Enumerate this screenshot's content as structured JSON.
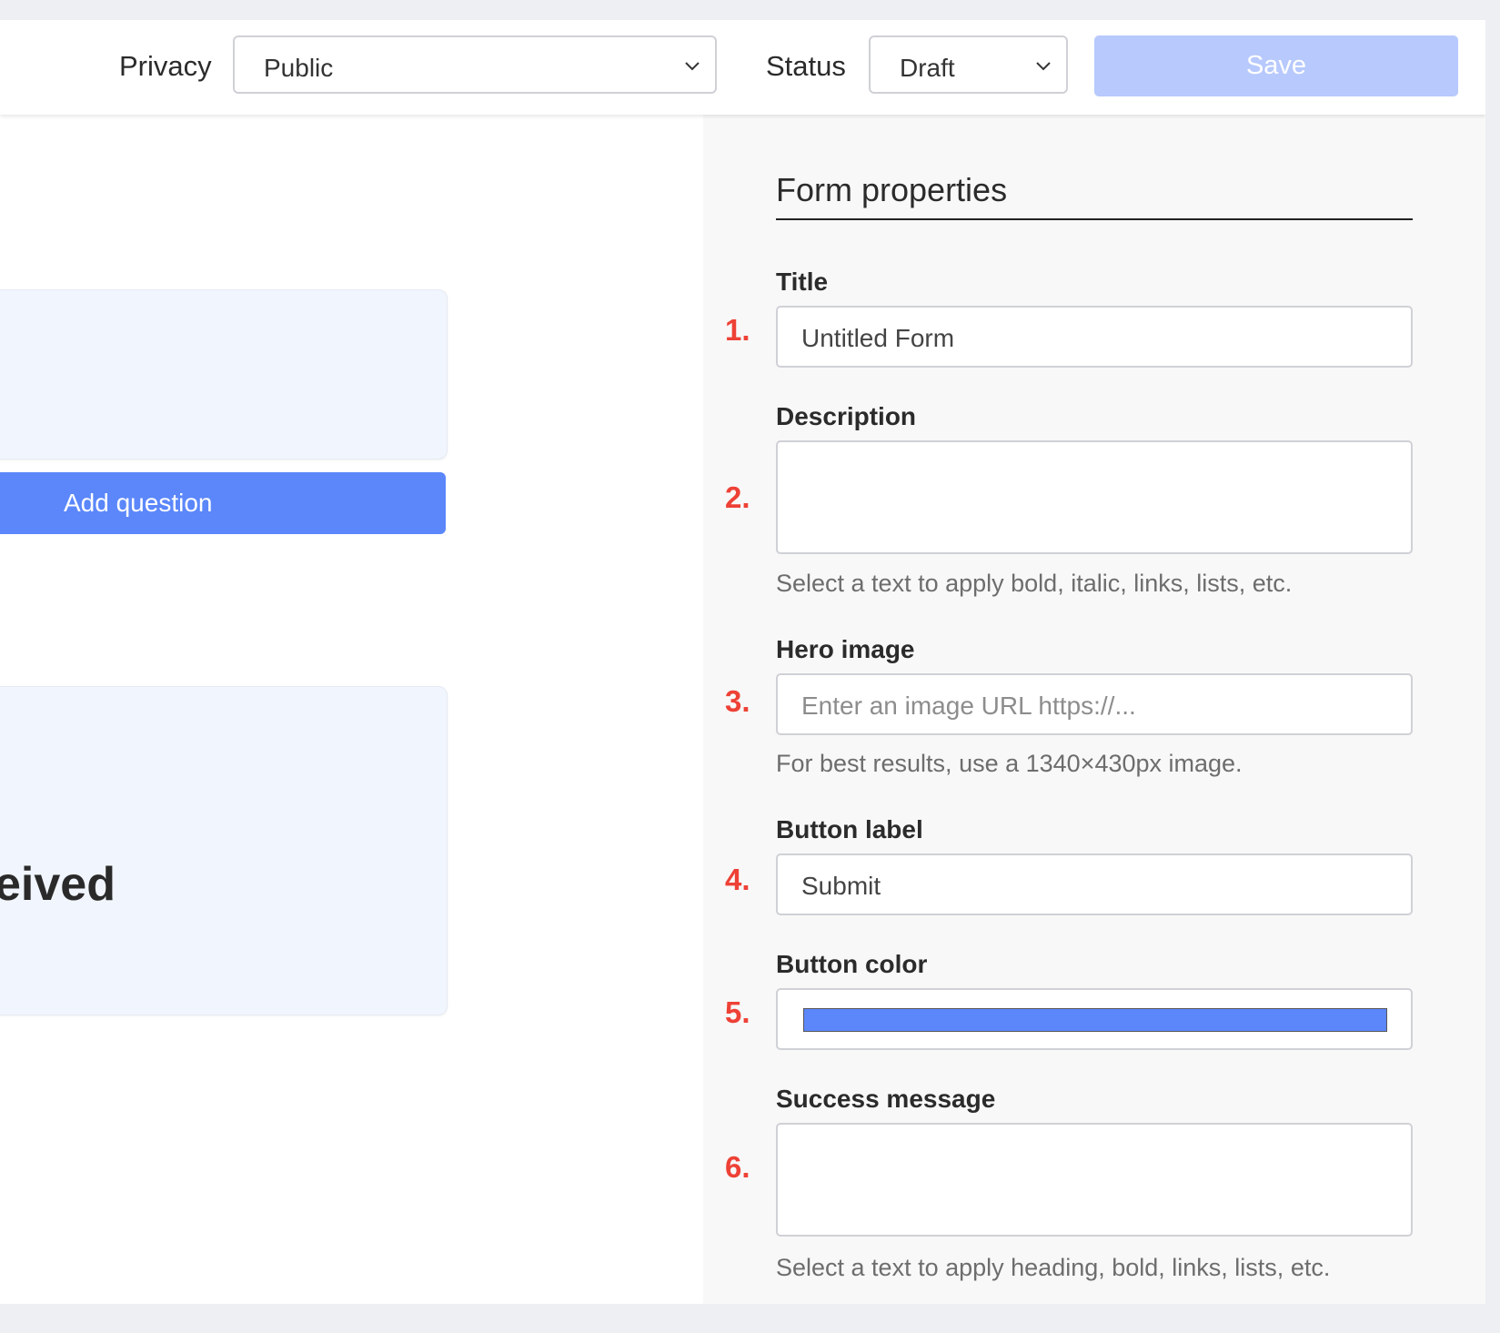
{
  "header": {
    "privacy_label": "Privacy",
    "privacy_value": "Public",
    "status_label": "Status",
    "status_value": "Draft",
    "save_label": "Save"
  },
  "canvas": {
    "add_question_label": "Add question",
    "partial_heading": "eived"
  },
  "panel": {
    "title": "Form properties",
    "fields": {
      "title": {
        "number": "1.",
        "label": "Title",
        "value": "Untitled Form"
      },
      "description": {
        "number": "2.",
        "label": "Description",
        "value": "",
        "hint": "Select a text to apply bold, italic, links, lists, etc."
      },
      "hero_image": {
        "number": "3.",
        "label": "Hero image",
        "placeholder": "Enter an image URL https://...",
        "hint": "For best results, use a 1340×430px image."
      },
      "button_label": {
        "number": "4.",
        "label": "Button label",
        "value": "Submit"
      },
      "button_color": {
        "number": "5.",
        "label": "Button color",
        "value": "#5b87fb"
      },
      "success_message": {
        "number": "6.",
        "label": "Success message",
        "value": "",
        "hint": "Select a text to apply heading, bold, links, lists, etc."
      }
    }
  },
  "colors": {
    "accent": "#5b87fb",
    "save_disabled": "#b7c9fd",
    "number_marker": "#ee4136",
    "card_bg": "#f1f5fd"
  },
  "icons": {
    "select_chevron": "chevron-down-icon"
  }
}
